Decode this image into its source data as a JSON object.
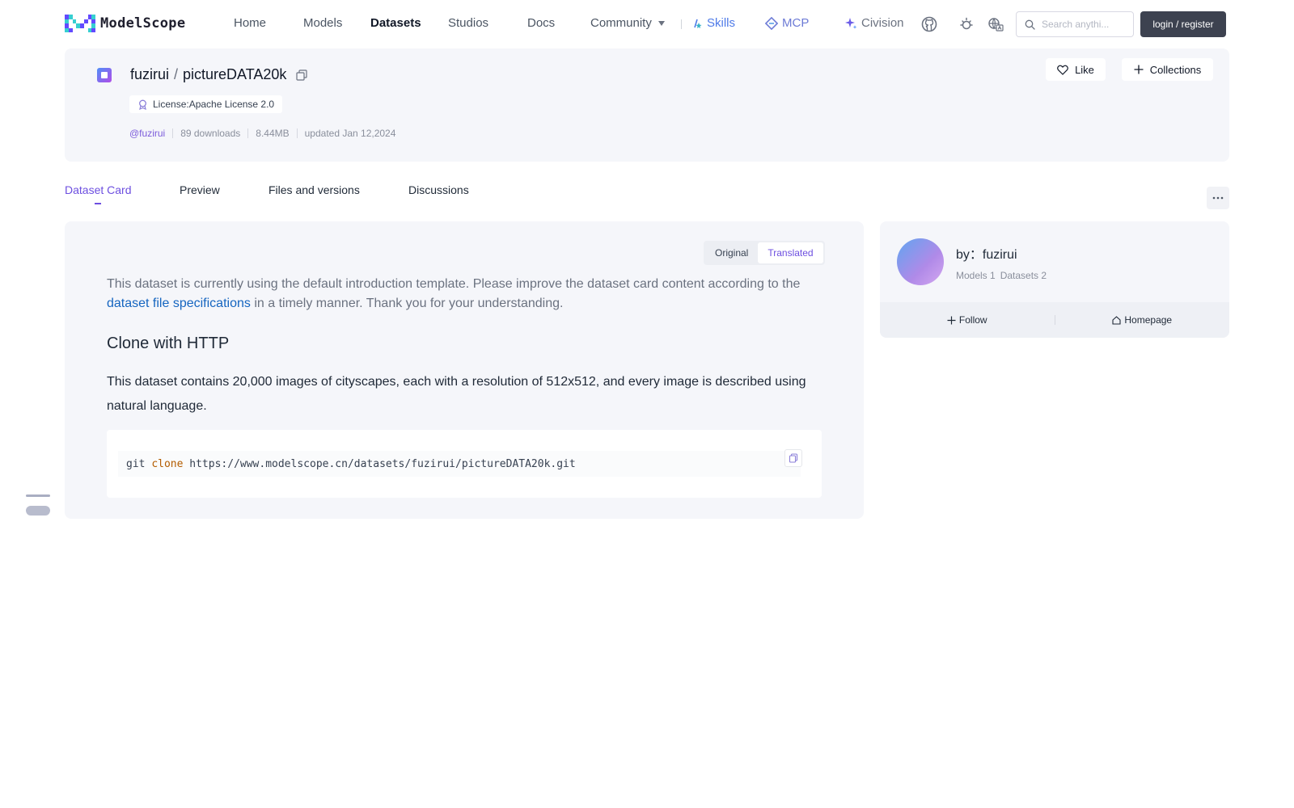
{
  "header": {
    "logo_text": "ModelScope",
    "nav": [
      {
        "label": "Home"
      },
      {
        "label": "Models"
      },
      {
        "label": "Datasets",
        "active": true
      },
      {
        "label": "Studios"
      },
      {
        "label": "Docs"
      },
      {
        "label": "Community",
        "has_dropdown": true
      }
    ],
    "skills_label": "Skills",
    "mcp_label": "MCP",
    "civision_label": "Civision",
    "icons": [
      "github-icon",
      "theme-toggle-icon",
      "language-icon"
    ],
    "search_placeholder": "Search anythi...",
    "login_label": "login / register"
  },
  "dataset": {
    "owner": "fuzirui",
    "separator": "/",
    "name": "pictureDATA20k",
    "license": "License:Apache License 2.0",
    "user_link": "@fuzirui",
    "downloads": "89 downloads",
    "size": "8.44MB",
    "updated": "updated Jan 12,2024",
    "like_label": "Like",
    "collections_label": "Collections"
  },
  "tabs": [
    {
      "label": "Dataset Card",
      "active": true
    },
    {
      "label": "Preview"
    },
    {
      "label": "Files and versions"
    },
    {
      "label": "Discussions"
    }
  ],
  "card": {
    "toggle_original": "Original",
    "toggle_translated": "Translated",
    "toggle_selected": "Translated",
    "intro_before_link": "This dataset is currently using the default introduction template. Please improve the dataset card content according to the ",
    "intro_link": "dataset file specifications",
    "intro_after_link": " in a timely manner. Thank you for your understanding.",
    "heading": "Clone with HTTP",
    "description": "This dataset contains 20,000 images of cityscapes, each with a resolution of 512x512, and every image is described using natural language.",
    "code_cmd": "git ",
    "code_keyword": "clone",
    "code_url": " https://www.modelscope.cn/datasets/fuzirui/pictureDATA20k.git"
  },
  "author": {
    "by_label": "by：fuzirui",
    "models_count": "Models 1",
    "datasets_count": "Datasets 2",
    "follow_label": "Follow",
    "homepage_label": "Homepage"
  },
  "colors": {
    "accent": "#6d4fe0",
    "link": "#1565c0",
    "card_bg": "#f5f6fa",
    "login_bg": "#3d4250"
  }
}
